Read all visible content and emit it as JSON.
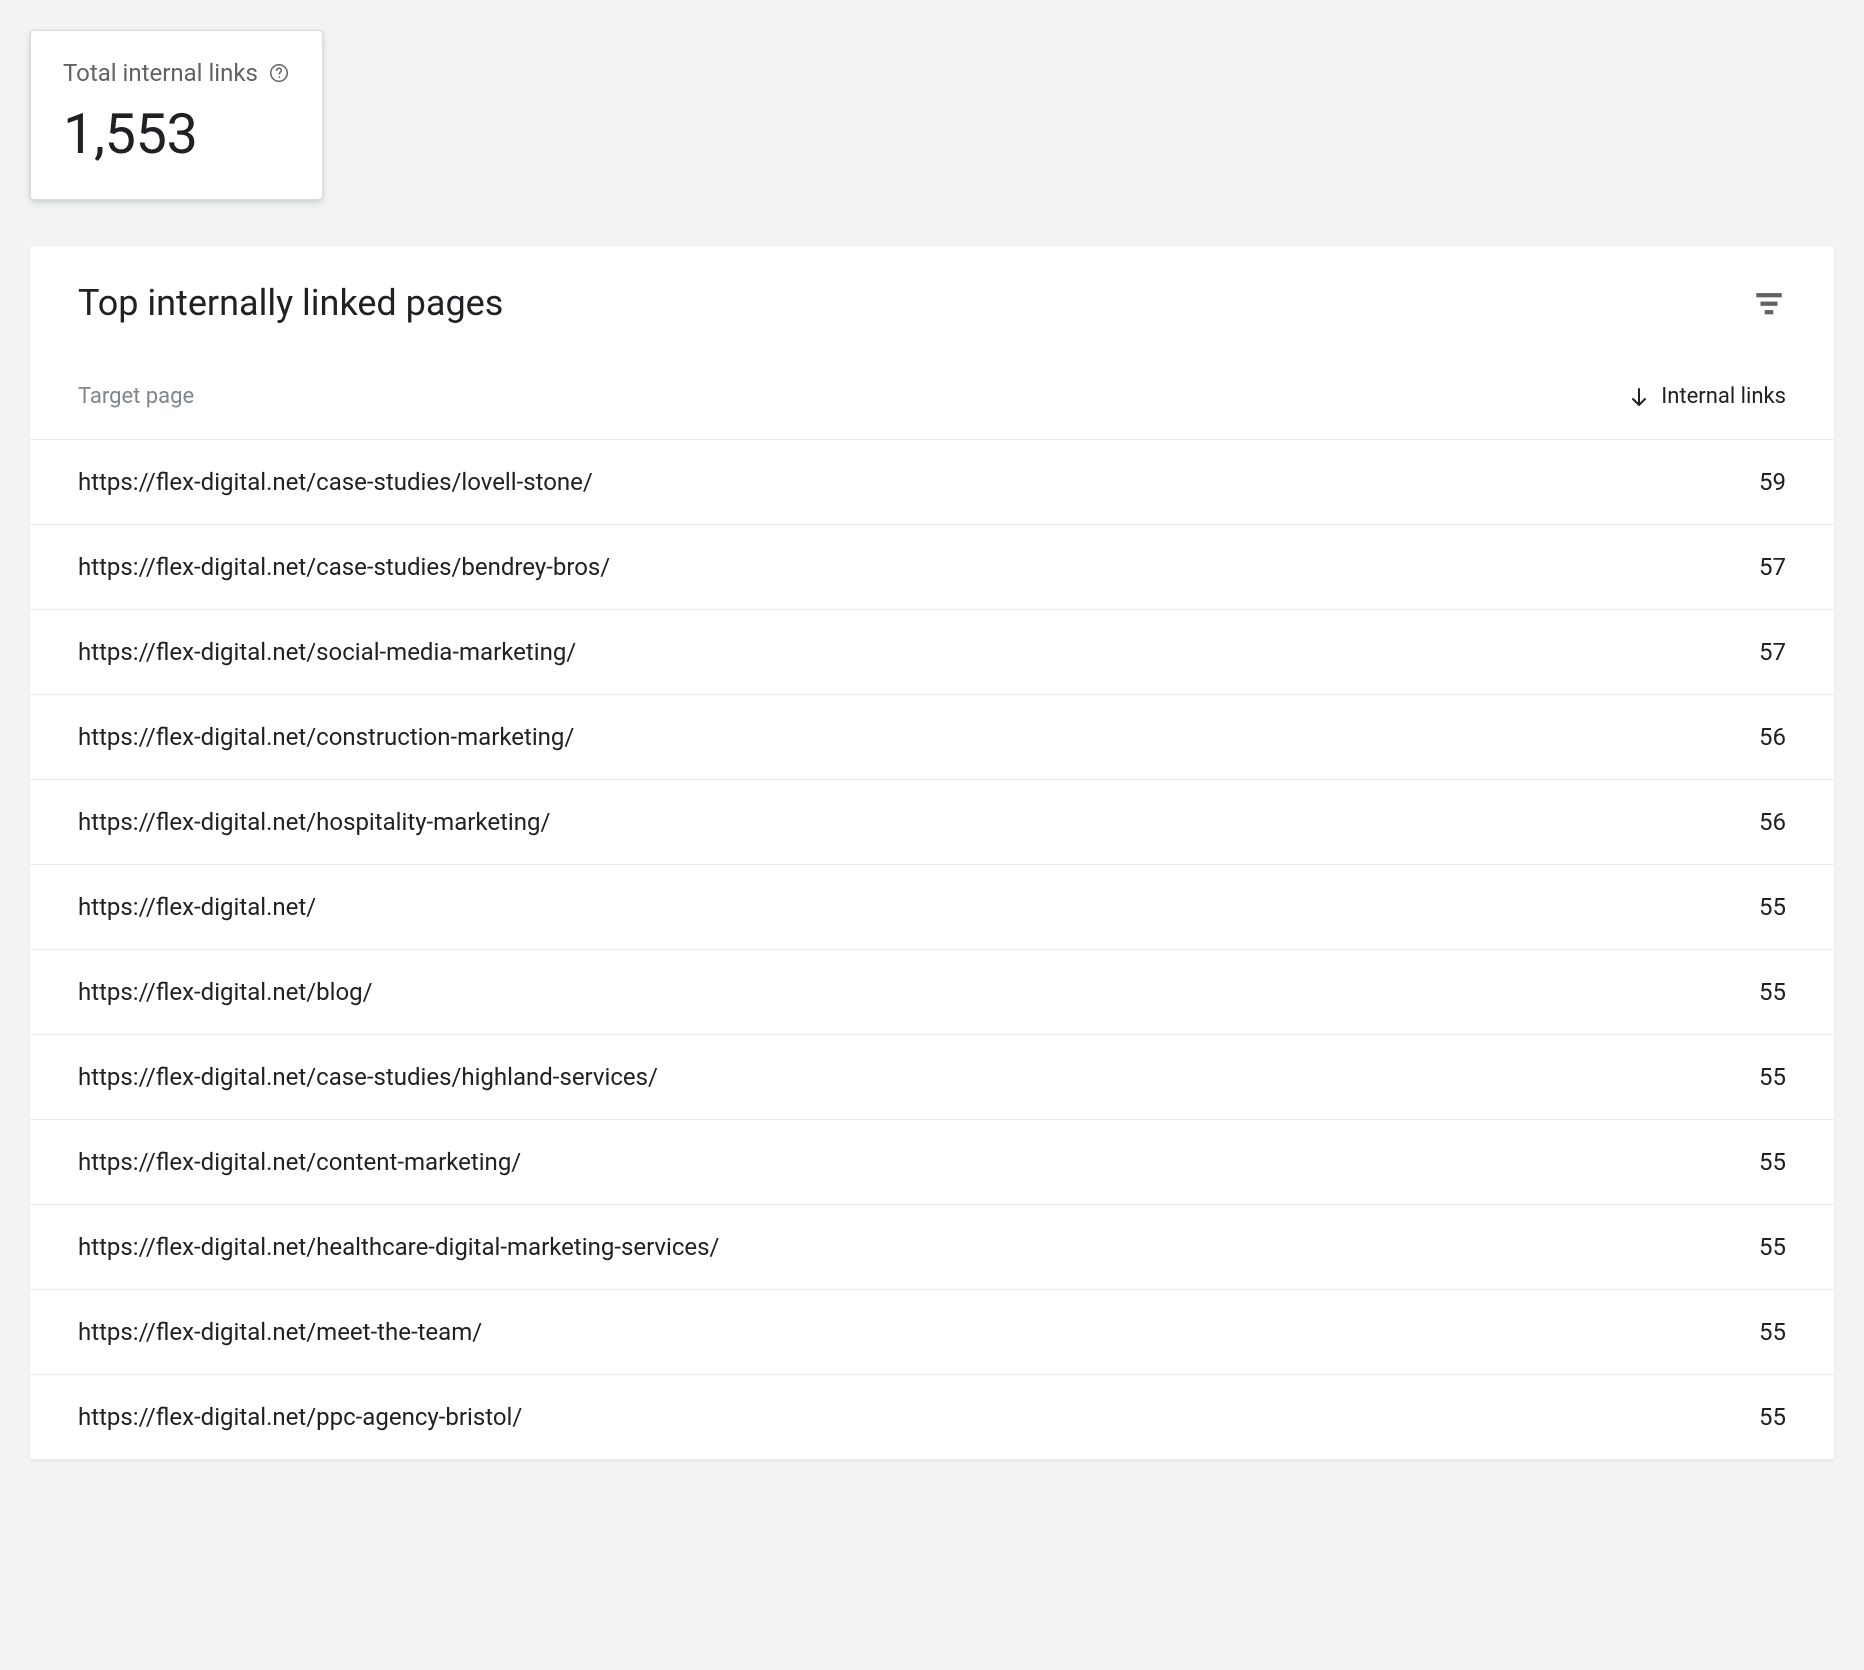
{
  "summary": {
    "total_label": "Total internal links",
    "total_value": "1,553"
  },
  "panel": {
    "title": "Top internally linked pages",
    "columns": {
      "target_page": "Target page",
      "internal_links": "Internal links"
    },
    "rows": [
      {
        "url": "https://flex-digital.net/case-studies/lovell-stone/",
        "count": "59"
      },
      {
        "url": "https://flex-digital.net/case-studies/bendrey-bros/",
        "count": "57"
      },
      {
        "url": "https://flex-digital.net/social-media-marketing/",
        "count": "57"
      },
      {
        "url": "https://flex-digital.net/construction-marketing/",
        "count": "56"
      },
      {
        "url": "https://flex-digital.net/hospitality-marketing/",
        "count": "56"
      },
      {
        "url": "https://flex-digital.net/",
        "count": "55"
      },
      {
        "url": "https://flex-digital.net/blog/",
        "count": "55"
      },
      {
        "url": "https://flex-digital.net/case-studies/highland-services/",
        "count": "55"
      },
      {
        "url": "https://flex-digital.net/content-marketing/",
        "count": "55"
      },
      {
        "url": "https://flex-digital.net/healthcare-digital-marketing-services/",
        "count": "55"
      },
      {
        "url": "https://flex-digital.net/meet-the-team/",
        "count": "55"
      },
      {
        "url": "https://flex-digital.net/ppc-agency-bristol/",
        "count": "55"
      }
    ]
  }
}
